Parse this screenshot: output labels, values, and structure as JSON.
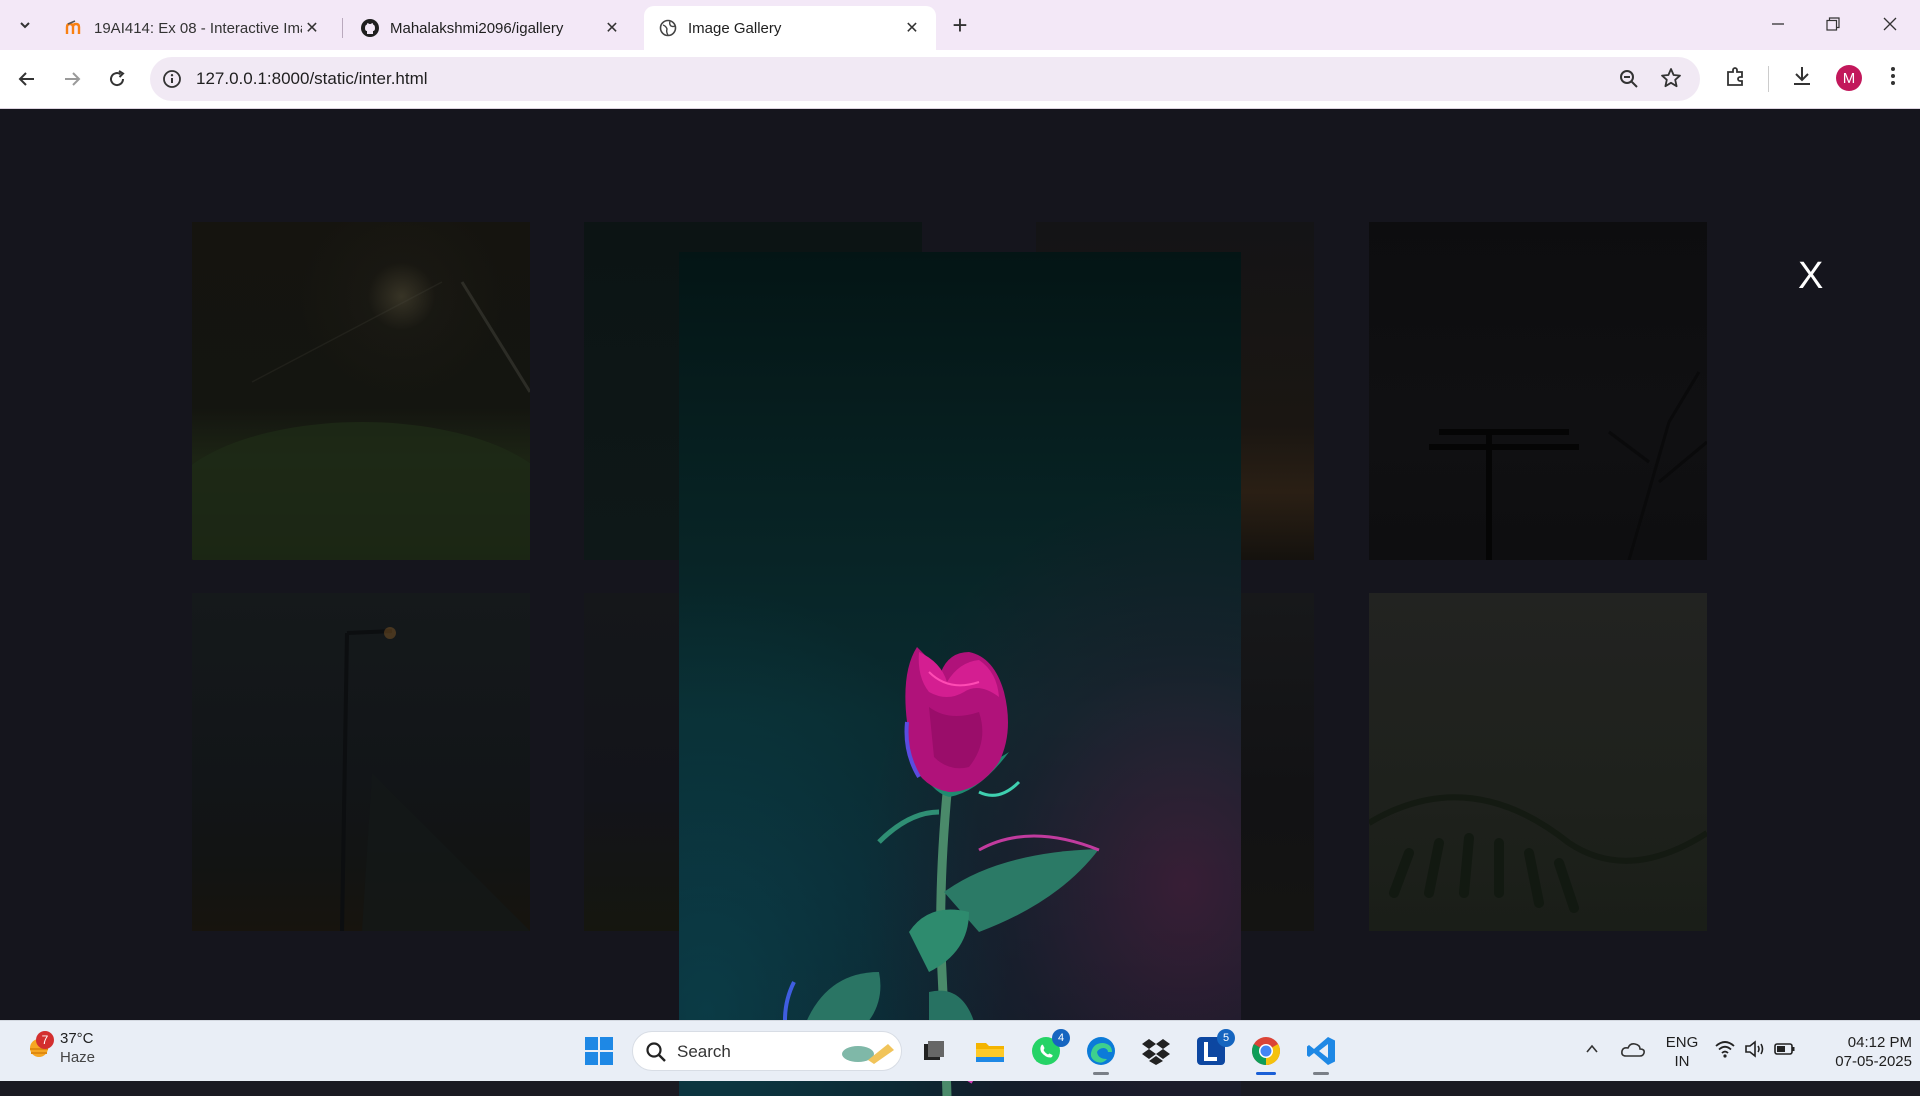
{
  "browser": {
    "tabs": [
      {
        "title": "19AI414: Ex 08 - Interactive Ima",
        "favicon": "moodle-icon",
        "active": false
      },
      {
        "title": "Mahalakshmi2096/igallery",
        "favicon": "github-icon",
        "active": false
      },
      {
        "title": "Image Gallery",
        "favicon": "globe-icon",
        "active": true
      }
    ],
    "new_tab_label": "+",
    "url": "127.0.0.1:8000/static/inter.html",
    "profile_initial": "M"
  },
  "gallery": {
    "close_label": "X",
    "thumbnails": [
      {
        "subject": "street light and trees at night"
      },
      {
        "subject": "dark teal scene"
      },
      {
        "subject": "dim orange lights"
      },
      {
        "subject": "power pole and bare tree"
      },
      {
        "subject": "wet road at night"
      },
      {
        "subject": "tree silhouettes"
      },
      {
        "subject": "dark scene"
      },
      {
        "subject": "fern leaves"
      }
    ],
    "lightbox": {
      "subject": "pink rose on teal background"
    }
  },
  "taskbar": {
    "weather": {
      "badge": "7",
      "temp": "37°C",
      "condition": "Haze"
    },
    "search_label": "Search",
    "apps": [
      {
        "name": "whatsapp",
        "badge": "4"
      },
      {
        "name": "l-app",
        "badge": "5"
      }
    ],
    "lang": {
      "line1": "ENG",
      "line2": "IN"
    },
    "clock": {
      "time": "04:12 PM",
      "date": "07-05-2025"
    }
  },
  "colors": {
    "accent": "#1a5fd6",
    "titlebar": "#f3e8f7",
    "page_bg": "#15151d",
    "avatar": "#c2185b"
  }
}
